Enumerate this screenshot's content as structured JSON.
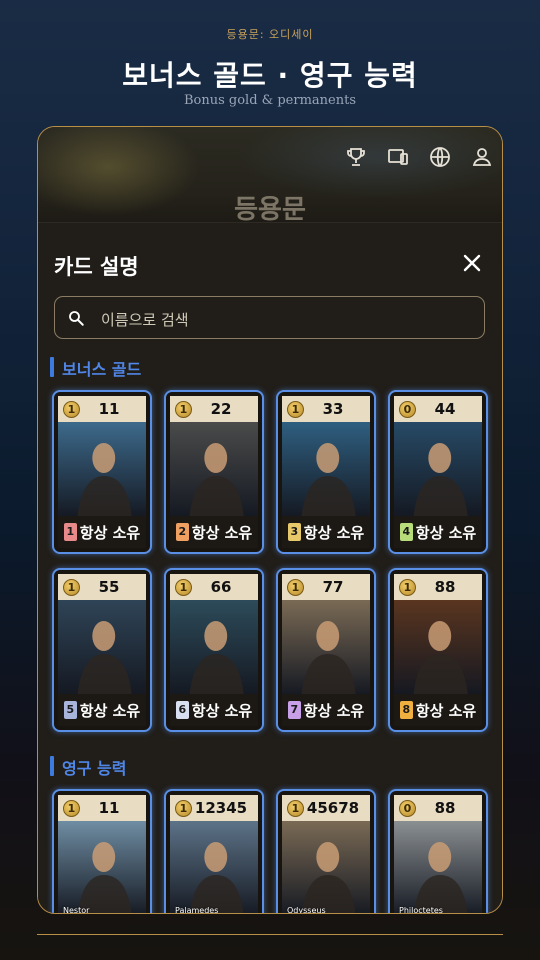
{
  "header": {
    "subtitle": "등용문: 오디세이",
    "title": "보너스 골드 · 영구 능력",
    "caption": "Bonus gold & permanents"
  },
  "hero": {
    "title": "등용문",
    "icons": [
      "trophy-icon",
      "devices-icon",
      "globe-icon",
      "person-icon"
    ]
  },
  "sheet": {
    "title": "카드 설명",
    "search_placeholder": "이름으로 검색"
  },
  "sections": [
    {
      "title": "보너스 골드",
      "cards": [
        {
          "cost": "1",
          "value": "11",
          "badge": "1",
          "badge_color": "#e98a8a",
          "label": "항상 소유",
          "art": "#3d6a8c"
        },
        {
          "cost": "1",
          "value": "22",
          "badge": "2",
          "badge_color": "#f0a060",
          "label": "항상 소유",
          "art": "#4a4b4a"
        },
        {
          "cost": "1",
          "value": "33",
          "badge": "3",
          "badge_color": "#e7c96a",
          "label": "항상 소유",
          "art": "#2f5f80"
        },
        {
          "cost": "0",
          "value": "44",
          "badge": "4",
          "badge_color": "#b9dc7a",
          "label": "항상 소유",
          "art": "#274a66"
        },
        {
          "cost": "1",
          "value": "55",
          "badge": "5",
          "badge_color": "#a8b4dc",
          "label": "항상 소유",
          "art": "#2f4457"
        },
        {
          "cost": "1",
          "value": "66",
          "badge": "6",
          "badge_color": "#d8e0f0",
          "label": "항상 소유",
          "art": "#2d4b5a"
        },
        {
          "cost": "1",
          "value": "77",
          "badge": "7",
          "badge_color": "#c8a0e8",
          "label": "항상 소유",
          "art": "#7a6a55"
        },
        {
          "cost": "1",
          "value": "88",
          "badge": "8",
          "badge_color": "#f0b040",
          "label": "항상 소유",
          "art": "#5a3520"
        }
      ]
    },
    {
      "title": "영구 능력",
      "cards": [
        {
          "cost": "1",
          "value": "11",
          "name": "Nestor",
          "art": "#6f8da3"
        },
        {
          "cost": "1",
          "value": "12345",
          "name": "Palamedes",
          "art": "#5d7388"
        },
        {
          "cost": "1",
          "value": "45678",
          "name": "Odysseus",
          "art": "#7a6a55"
        },
        {
          "cost": "0",
          "value": "88",
          "name": "Philoctetes",
          "art": "#8a8f92"
        }
      ]
    }
  ],
  "colors": {
    "accent_gold": "#b88f47",
    "section_blue": "#4f86e8",
    "card_glow": "#5a8fe6"
  }
}
